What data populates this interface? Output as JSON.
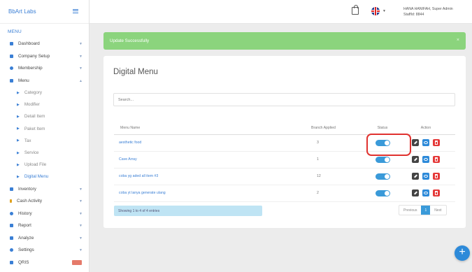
{
  "brand": "BbArt Labs",
  "sidebar": {
    "heading": "MENU",
    "items_top": [
      {
        "label": "Dashboard",
        "icon": "dashboard-icon",
        "color": "#3a7fd5"
      },
      {
        "label": "Company Setup",
        "icon": "company-icon",
        "color": "#3a7fd5"
      },
      {
        "label": "Membership",
        "icon": "membership-icon",
        "color": "#3a7fd5"
      },
      {
        "label": "Menu",
        "icon": "menu-icon",
        "color": "#3a7fd5"
      }
    ],
    "sub_items": [
      {
        "label": "Category"
      },
      {
        "label": "Modifier"
      },
      {
        "label": "Detail Item"
      },
      {
        "label": "Paket Item"
      },
      {
        "label": "Tax"
      },
      {
        "label": "Service"
      },
      {
        "label": "Upload File"
      },
      {
        "label": "Digital Menu"
      }
    ],
    "items_bottom": [
      {
        "label": "Inventory",
        "icon": "inventory-icon",
        "color": "#3a7fd5"
      },
      {
        "label": "Cash Activity",
        "icon": "cash-icon",
        "color": "#e0a21f"
      },
      {
        "label": "History",
        "icon": "history-icon",
        "color": "#3a7fd5"
      },
      {
        "label": "Report",
        "icon": "report-icon",
        "color": "#3a7fd5"
      },
      {
        "label": "Analyze",
        "icon": "analyze-icon",
        "color": "#3a7fd5"
      },
      {
        "label": "Settings",
        "icon": "settings-icon",
        "color": "#3a7fd5"
      },
      {
        "label": "QRIS",
        "icon": "qris-icon",
        "color": "#3a7fd5"
      }
    ]
  },
  "topbar": {
    "user_name": "HANA HANIFAH, Super Admin",
    "staff_id": "StaffId: 8844"
  },
  "alert": {
    "text": "Update Successfully"
  },
  "card": {
    "title": "Digital Menu",
    "search_placeholder": "Search...",
    "columns": [
      "Menu Name",
      "Branch Applied",
      "Status",
      "Action"
    ],
    "rows": [
      {
        "name": "aesthetic food",
        "branch": "3",
        "status": "on"
      },
      {
        "name": "Cave Array",
        "branch": "1",
        "status": "on"
      },
      {
        "name": "coba yg aded all item #3",
        "branch": "12",
        "status": "on"
      },
      {
        "name": "coba yt lanya generate ulang",
        "branch": "2",
        "status": "on"
      }
    ],
    "info": "Showing 1 to 4 of 4 entries",
    "pager": {
      "previous": "Previous",
      "current": "1",
      "next": "Next"
    }
  },
  "fab_label": "+",
  "colors": {
    "accent": "#3a9ad9",
    "success": "#8bd47d",
    "danger": "#e53939",
    "highlight": "#e0322f"
  }
}
